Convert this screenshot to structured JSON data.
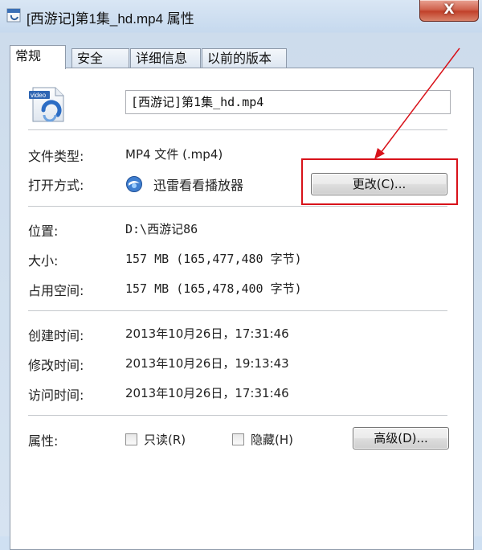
{
  "window": {
    "title": "[西游记]第1集_hd.mp4 属性",
    "close_glyph": "X"
  },
  "tabs": [
    {
      "label": "常规",
      "active": true
    },
    {
      "label": "安全",
      "active": false
    },
    {
      "label": "详细信息",
      "active": false
    },
    {
      "label": "以前的版本",
      "active": false
    }
  ],
  "general": {
    "icon_caption": "video",
    "file_name": "[西游记]第1集_hd.mp4",
    "file_type_label": "文件类型:",
    "file_type_value": "MP4 文件 (.mp4)",
    "opens_with_label": "打开方式:",
    "opens_with_value": "迅雷看看播放器",
    "change_button": "更改(C)...",
    "location_label": "位置:",
    "location_value": "D:\\西游记86",
    "size_label": "大小:",
    "size_value": "157 MB (165,477,480 字节)",
    "size_on_disk_label": "占用空间:",
    "size_on_disk_value": "157 MB (165,478,400 字节)",
    "created_label": "创建时间:",
    "created_value": "2013年10月26日，17:31:46",
    "modified_label": "修改时间:",
    "modified_value": "2013年10月26日，19:13:43",
    "accessed_label": "访问时间:",
    "accessed_value": "2013年10月26日，17:31:46",
    "attributes_label": "属性:",
    "readonly_label": "只读(R)",
    "readonly_checked": false,
    "hidden_label": "隐藏(H)",
    "hidden_checked": false,
    "advanced_button": "高级(D)..."
  },
  "colors": {
    "annotation_red": "#d8121a",
    "title_bar": "#cfe0f2"
  }
}
